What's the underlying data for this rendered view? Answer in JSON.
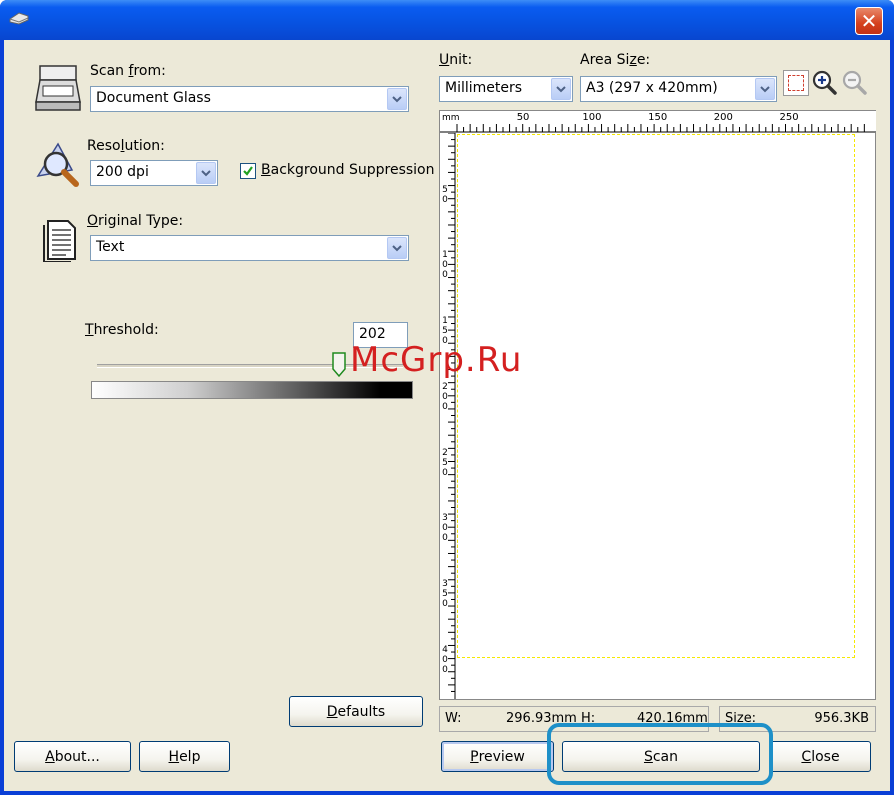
{
  "title_bar": {
    "close_glyph": "✕"
  },
  "scan_from": {
    "label_pre": "Scan ",
    "label_ul": "f",
    "label_post": "rom:",
    "value": "Document Glass"
  },
  "resolution": {
    "label_pre": "Reso",
    "label_ul": "l",
    "label_post": "ution:",
    "value": "200 dpi"
  },
  "background_suppression": {
    "checked": true,
    "label_ul": "B",
    "label_post": "ackground Suppression"
  },
  "original_type": {
    "label_ul": "O",
    "label_post": "riginal Type:",
    "value": "Text"
  },
  "threshold": {
    "label_ul": "T",
    "label_post": "hreshold:",
    "value": "202",
    "min": 0,
    "max": 255
  },
  "buttons": {
    "defaults": {
      "ul": "D",
      "rest": "efaults"
    },
    "about": {
      "ul": "A",
      "rest": "bout..."
    },
    "help": {
      "ul": "H",
      "rest": "elp"
    },
    "preview": {
      "ul": "P",
      "rest": "review"
    },
    "scan": {
      "ul": "S",
      "rest": "can"
    },
    "close": {
      "ul": "C",
      "rest": "lose"
    }
  },
  "unit": {
    "label_ul": "U",
    "label_post": "nit:",
    "value": "Millimeters"
  },
  "area_size": {
    "label_pre": "Area Si",
    "label_ul": "z",
    "label_post": "e:",
    "value": "A3 (297 x 420mm)"
  },
  "ruler": {
    "unit_label": "mm",
    "h_ticks": [
      "50",
      "100",
      "150",
      "200",
      "250"
    ],
    "v_ticks": [
      "50",
      "100",
      "150",
      "200",
      "250",
      "300",
      "350",
      "400"
    ]
  },
  "status": {
    "w_label": "W:",
    "w_value": "296.93mm",
    "h_label": "H:",
    "h_value": "420.16mm",
    "size_label": "Size:",
    "size_value": "956.3KB"
  },
  "watermark": "McGrp.Ru",
  "colors": {
    "accent": "#0a3fd6",
    "highlight": "#1e90c8",
    "selection": "#f5e800"
  }
}
